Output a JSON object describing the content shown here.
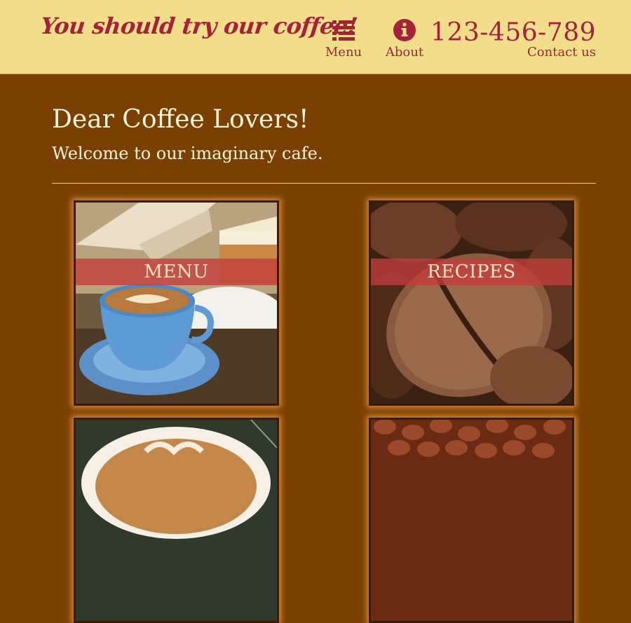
{
  "header": {
    "tagline": "You should try our coffee!",
    "nav": {
      "menu_label": "Menu",
      "menu_icon": "list-icon",
      "about_label": "About",
      "about_icon": "info-circle-icon"
    },
    "phone": "123-456-789",
    "contact_label": "Contact us"
  },
  "main": {
    "title": "Dear Coffee Lovers!",
    "subtitle": "Welcome to our imaginary cafe.",
    "tiles": [
      {
        "label": "MENU"
      },
      {
        "label": "RECIPES"
      },
      {
        "label": ""
      },
      {
        "label": ""
      }
    ]
  },
  "colors": {
    "header_bg": "#f2dd8b",
    "accent": "#a3233a",
    "page_bg": "#7a4001",
    "text_light": "#fbf3dc",
    "band": "#c43c3c"
  }
}
